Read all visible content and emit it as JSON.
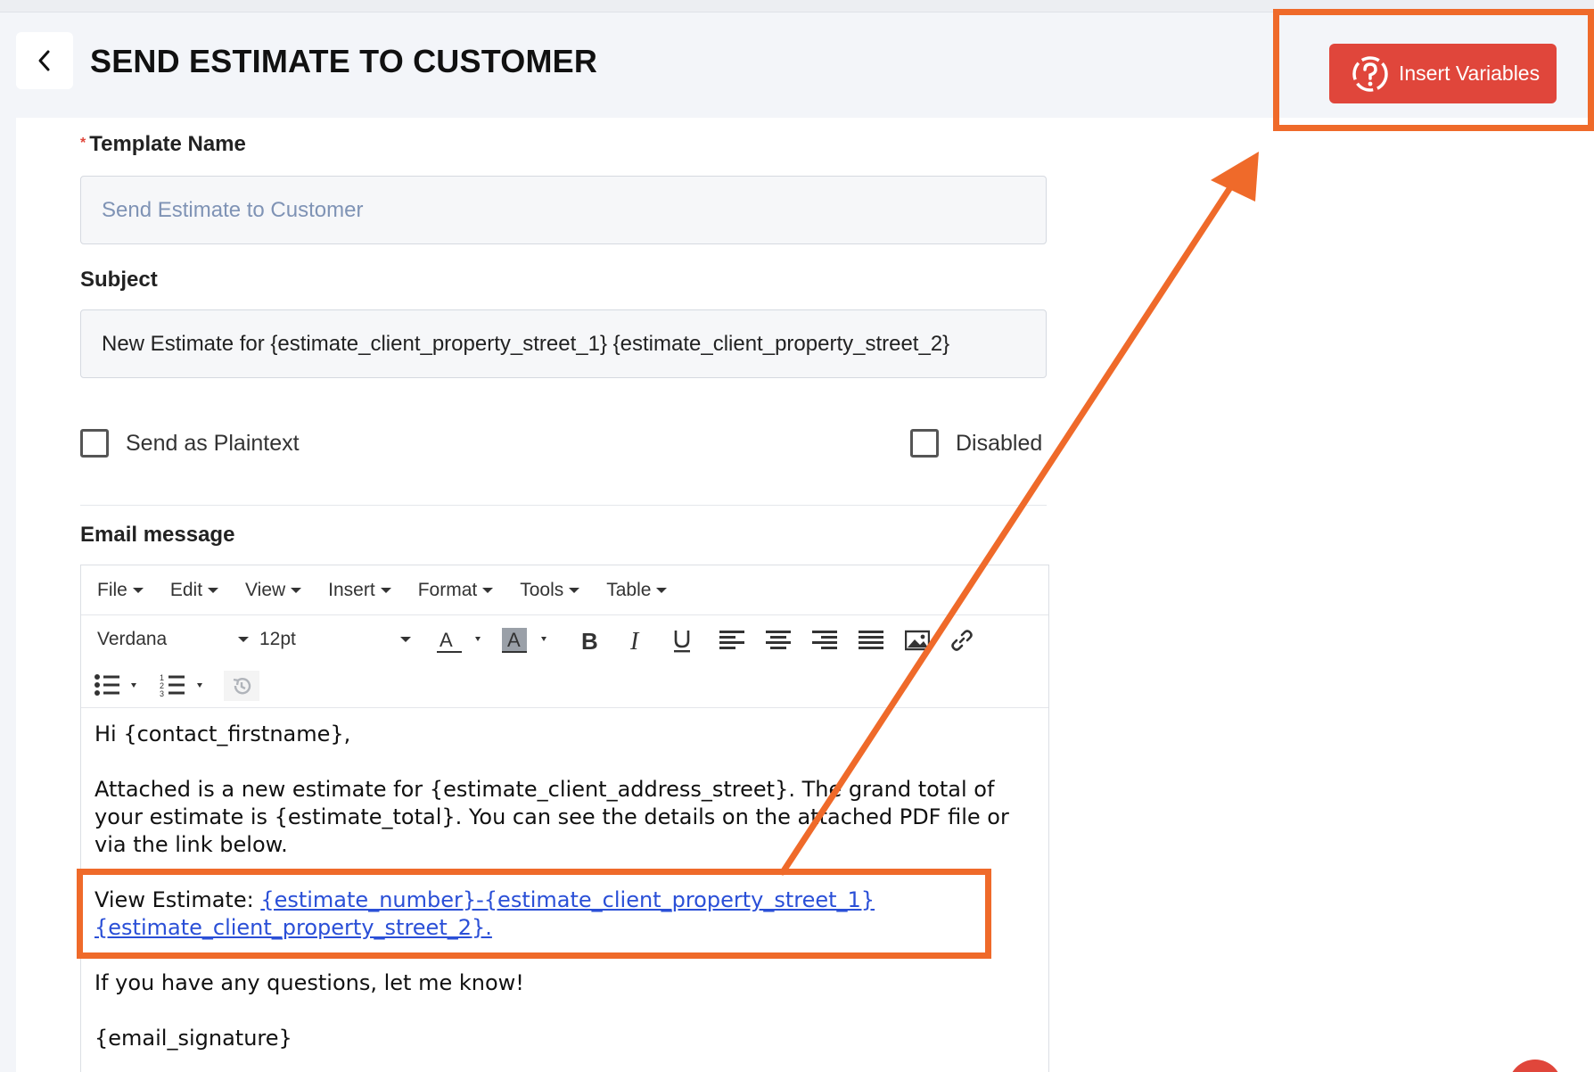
{
  "header": {
    "title": "SEND ESTIMATE TO CUSTOMER",
    "insert_variables_label": "Insert Variables"
  },
  "form": {
    "template_name": {
      "label": "Template Name",
      "required_mark": "*",
      "placeholder": "Send  Estimate to Customer"
    },
    "subject": {
      "label": "Subject",
      "value": "New Estimate for {estimate_client_property_street_1} {estimate_client_property_street_2}"
    },
    "send_plaintext": {
      "label": "Send as Plaintext",
      "checked": false
    },
    "disabled": {
      "label": "Disabled",
      "checked": false
    },
    "email_message_label": "Email message"
  },
  "editor": {
    "menus": [
      "File",
      "Edit",
      "View",
      "Insert",
      "Format",
      "Tools",
      "Table"
    ],
    "font_family": "Verdana",
    "font_size": "12pt",
    "content": {
      "greeting": "Hi {contact_firstname},",
      "paragraph": "Attached is a new estimate for {estimate_client_address_street}. The grand total of your estimate is {estimate_total}. You can see the details on the attached PDF file or via the link below.",
      "view_estimate_prefix": "View Estimate: ",
      "view_estimate_link": "{estimate_number}-{estimate_client_property_street_1} {estimate_client_property_street_2}.",
      "questions": "If you have any questions, let me know!",
      "signature": "{email_signature}"
    }
  },
  "colors": {
    "accent": "#e0463b",
    "annotation": "#ef6a2a",
    "link": "#2a4fd7"
  }
}
